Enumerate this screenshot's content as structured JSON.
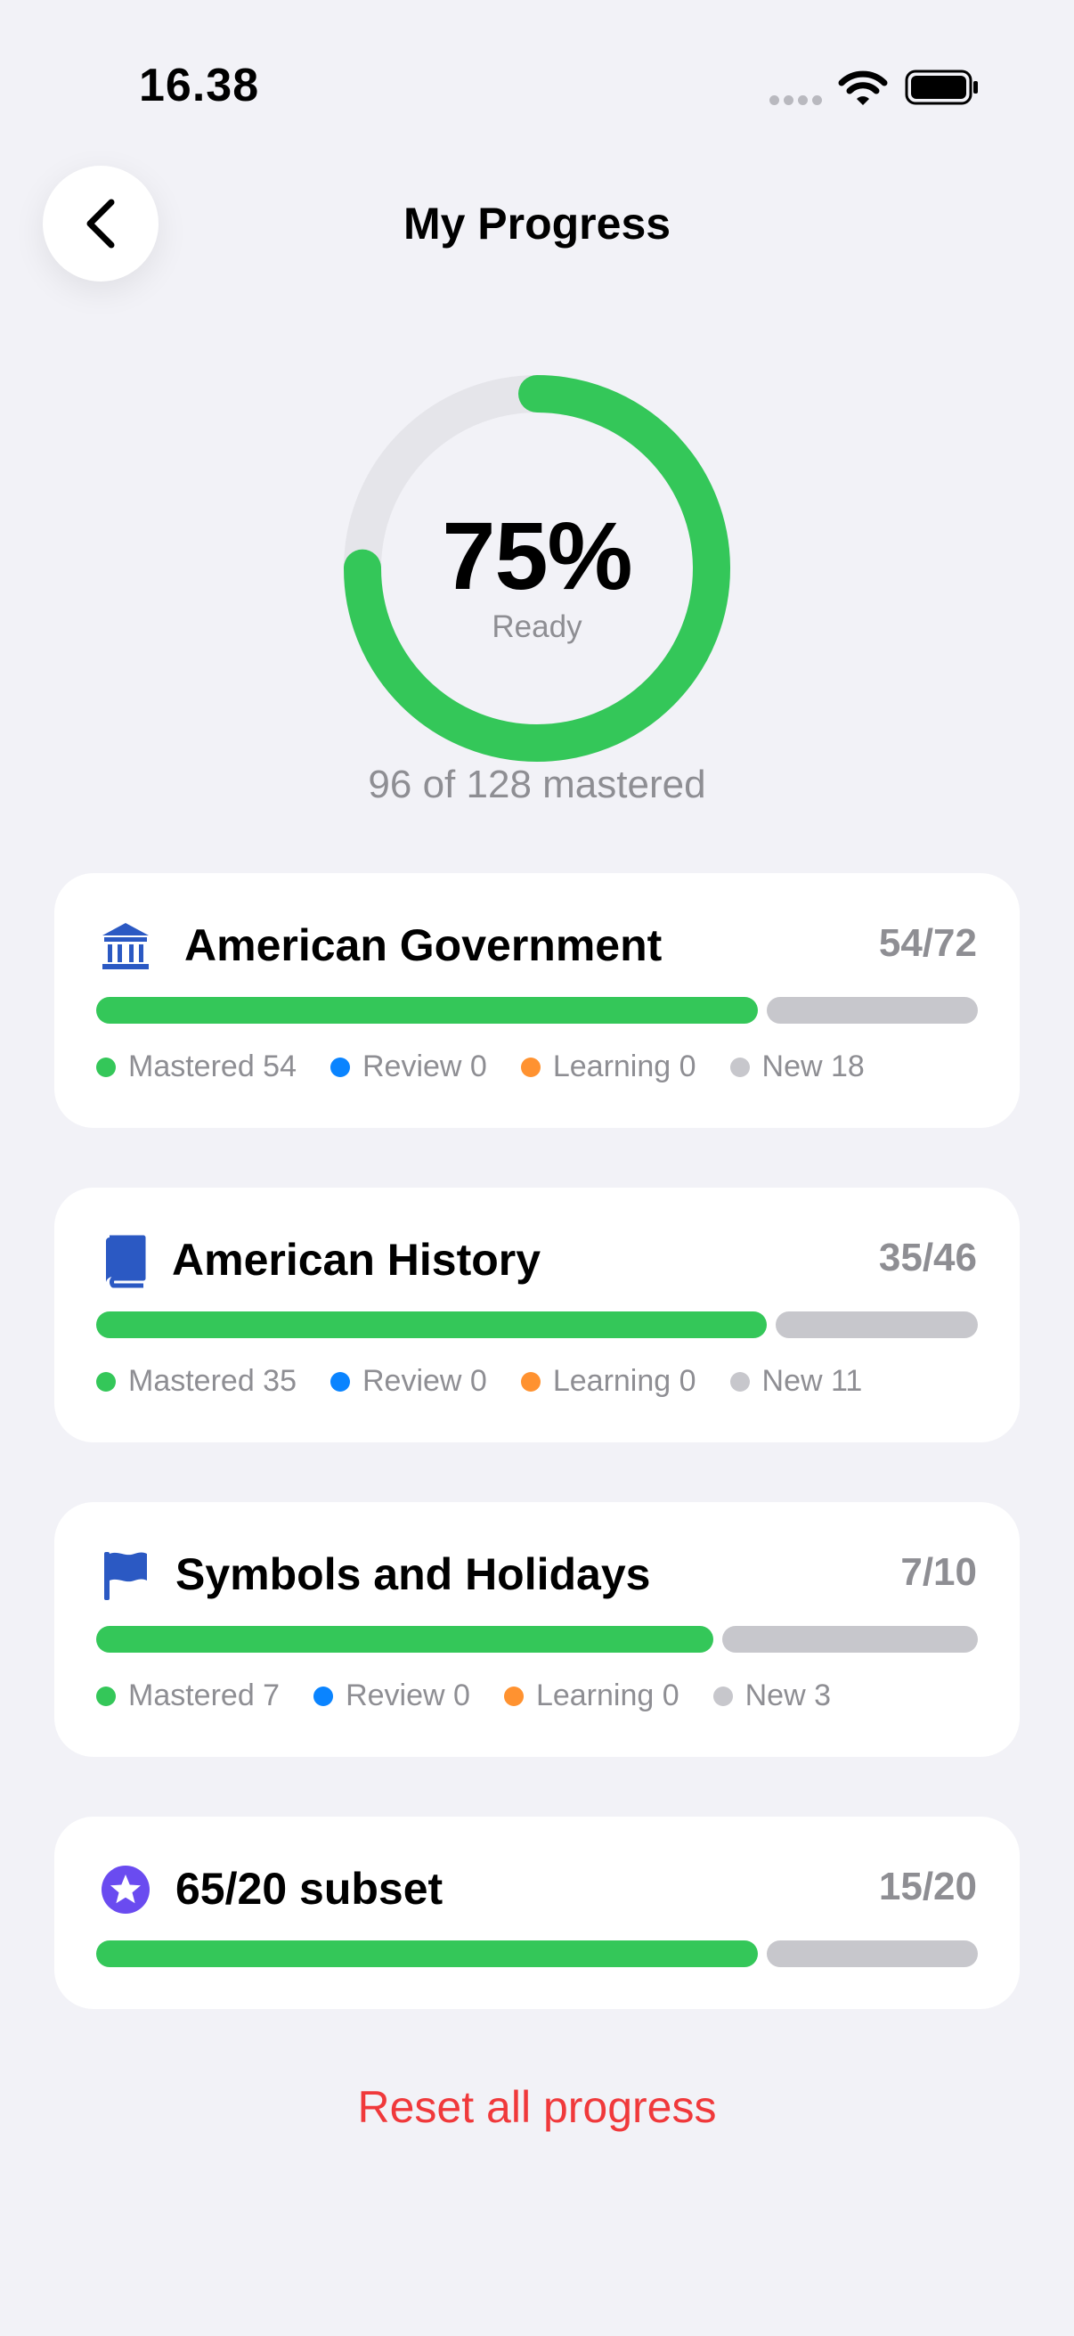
{
  "status_bar": {
    "time": "16.38",
    "wifi_icon": "wifi-icon",
    "battery_icon": "battery-full-icon"
  },
  "header": {
    "title": "My Progress",
    "back_icon": "chevron-left-icon"
  },
  "readiness": {
    "percent_label": "75%",
    "percent_value": 75,
    "caption": "Ready",
    "summary": "96 of 128 mastered",
    "mastered": 96,
    "total": 128
  },
  "categories": [
    {
      "icon": "building-columns-icon",
      "title": "American Government",
      "count": "54/72",
      "mastered_fraction": 0.75,
      "legend": [
        {
          "label": "Mastered 54",
          "color": "#34C759"
        },
        {
          "label": "Review 0",
          "color": "#0A84FF"
        },
        {
          "label": "Learning 0",
          "color": "#FF9230"
        },
        {
          "label": "New 18",
          "color": "#C7C7CC"
        }
      ]
    },
    {
      "icon": "book-icon",
      "title": "American History",
      "count": "35/46",
      "mastered_fraction": 0.761,
      "legend": [
        {
          "label": "Mastered 35",
          "color": "#34C759"
        },
        {
          "label": "Review 0",
          "color": "#0A84FF"
        },
        {
          "label": "Learning 0",
          "color": "#FF9230"
        },
        {
          "label": "New 11",
          "color": "#C7C7CC"
        }
      ]
    },
    {
      "icon": "flag-icon",
      "title": "Symbols and Holidays",
      "count": "7/10",
      "mastered_fraction": 0.7,
      "legend": [
        {
          "label": "Mastered 7",
          "color": "#34C759"
        },
        {
          "label": "Review 0",
          "color": "#0A84FF"
        },
        {
          "label": "Learning 0",
          "color": "#FF9230"
        },
        {
          "label": "New 3",
          "color": "#C7C7CC"
        }
      ]
    },
    {
      "icon": "star-circle-icon",
      "title": "65/20 subset",
      "count": "15/20",
      "mastered_fraction": 0.75,
      "legend": []
    }
  ],
  "colors": {
    "accent_green": "#34C759",
    "icon_blue": "#2B59C3",
    "star_purple": "#6A4BF0",
    "destructive_red": "#F0393B",
    "track_gray": "#C7C7CC"
  },
  "footer": {
    "reset_label": "Reset all progress"
  }
}
